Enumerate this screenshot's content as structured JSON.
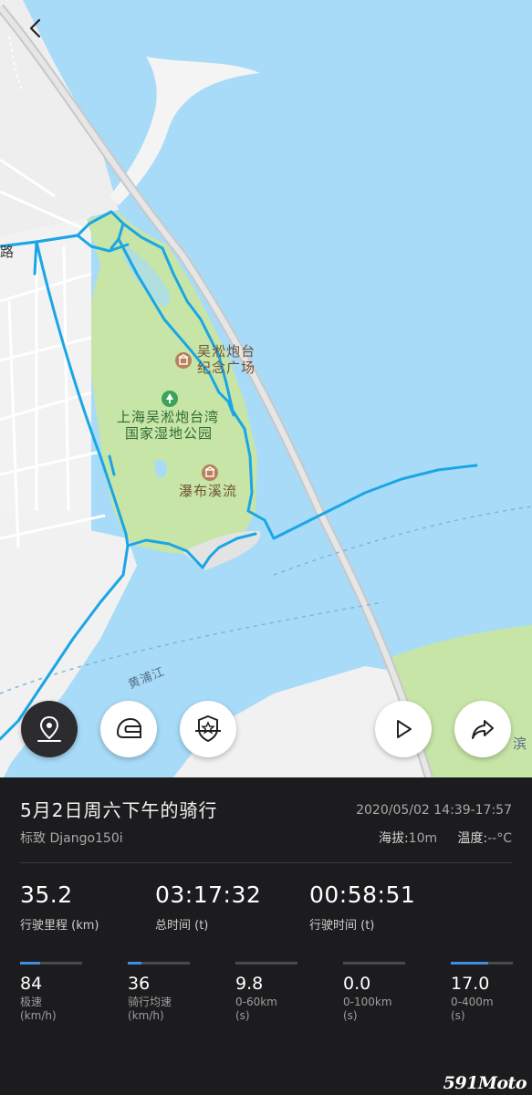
{
  "map": {
    "labels": {
      "road_fragment": "路",
      "fort_name_line1": "吴淞炮台",
      "fort_name_line2": "纪念广场",
      "park_name_line1": "上海吴淞炮台湾",
      "park_name_line2": "国家湿地公园",
      "waterfall": "瀑布溪流",
      "river": "黄浦江",
      "right_edge": "滨"
    },
    "route_color": "#1aa6e6",
    "water_color": "#a8dbf7",
    "park_color": "#c7e5a6"
  },
  "controls": {
    "back_icon": "chevron-left-icon",
    "location_icon": "map-pin-icon",
    "helmet_icon": "helmet-icon",
    "badge_icon": "medal-badge-icon",
    "play_icon": "play-icon",
    "share_icon": "share-icon"
  },
  "ride": {
    "title": "5月2日周六下午的骑行",
    "datetime": "2020/05/02 14:39-17:57",
    "bike": "标致 Django150i",
    "altitude_label": "海拔:",
    "altitude_value": "10m",
    "temperature_label": "温度:",
    "temperature_value": "--°C"
  },
  "main_stats": [
    {
      "value": "35.2",
      "caption": "行驶里程 (km)"
    },
    {
      "value": "03:17:32",
      "caption": "总时间 (t)"
    },
    {
      "value": "00:58:51",
      "caption": "行驶时间 (t)"
    }
  ],
  "mini_stats": [
    {
      "value": "84",
      "caption": "极速",
      "unit": "(km/h)",
      "fill": 0.33
    },
    {
      "value": "36",
      "caption": "骑行均速",
      "unit": "(km/h)",
      "fill": 0.22
    },
    {
      "value": "9.8",
      "caption": "0-60km",
      "unit": "(s)",
      "fill": 0
    },
    {
      "value": "0.0",
      "caption": "0-100km",
      "unit": "(s)",
      "fill": 0
    },
    {
      "value": "17.0",
      "caption": "0-400m",
      "unit": "(s)",
      "fill": 0.6
    }
  ],
  "watermark": "591Moto"
}
